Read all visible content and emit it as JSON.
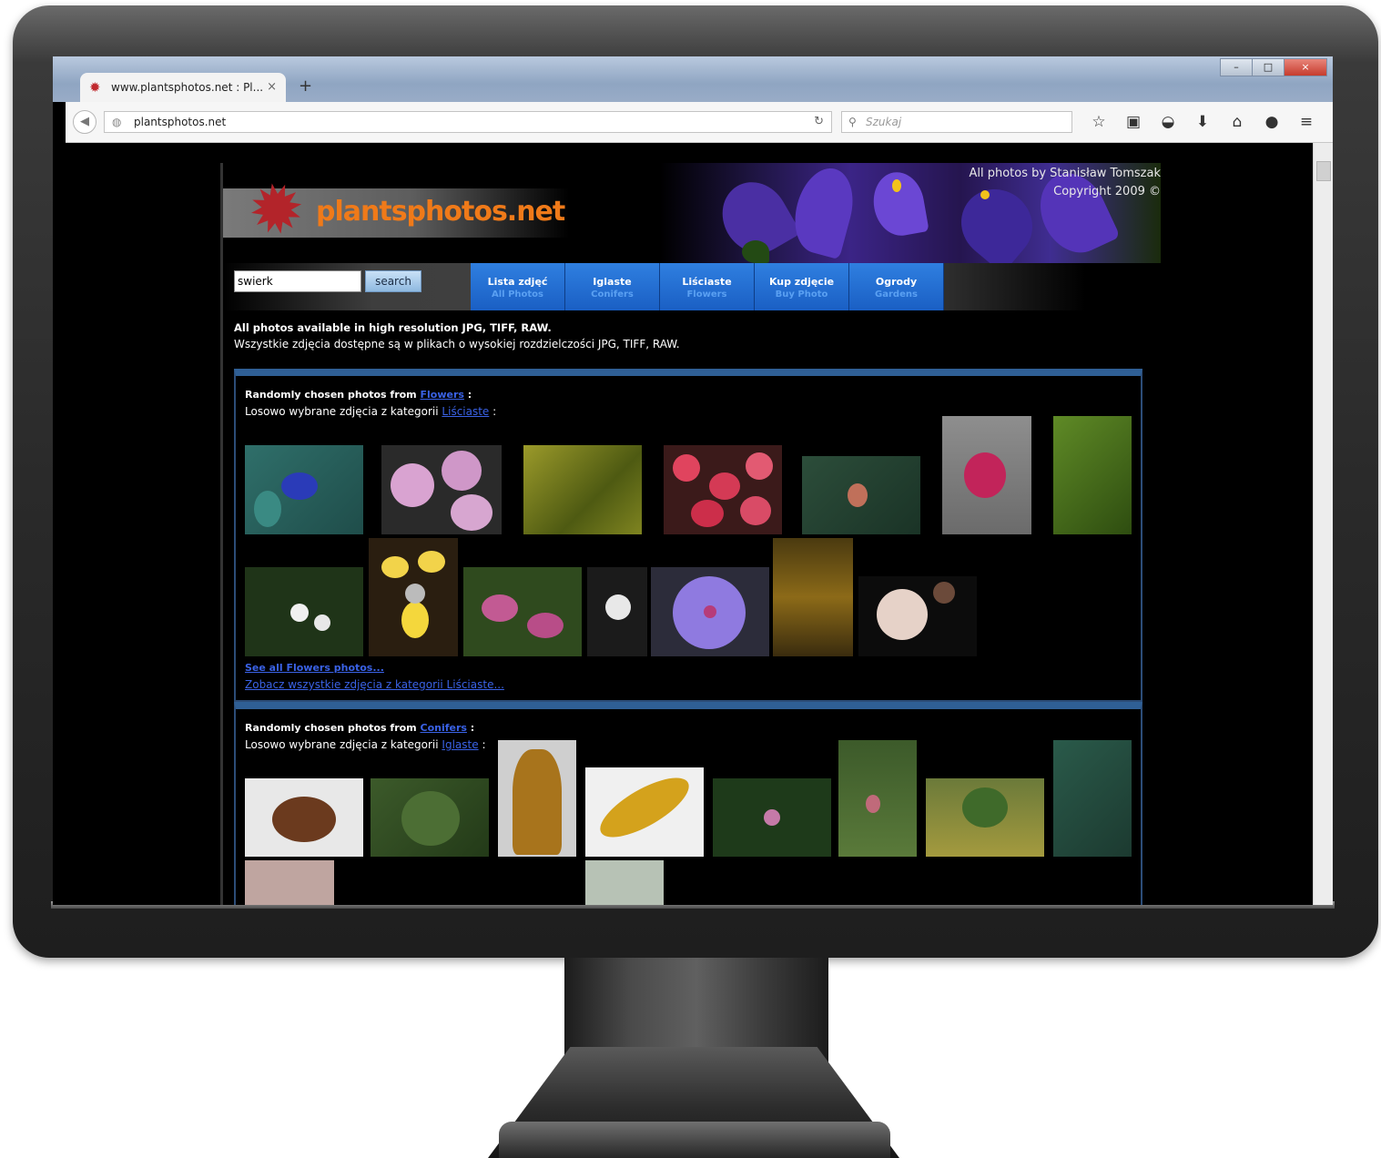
{
  "browser": {
    "tab_title": "www.plantsphotos.net : Pl...",
    "tab_close": "×",
    "new_tab": "+",
    "url": "plantsphotos.net",
    "search_placeholder": "Szukaj",
    "window_minimize": "–",
    "window_maximize": "□",
    "window_close": "×"
  },
  "site": {
    "logo": "plantsphotos.net",
    "credit_line1": "All photos by Stanisław Tomszak",
    "credit_line2": "Copyright 2009 ©",
    "search_value": "swierk",
    "search_button": "search",
    "menu": [
      {
        "pl": "Lista zdjęć",
        "en": "All Photos"
      },
      {
        "pl": "Iglaste",
        "en": "Conifers"
      },
      {
        "pl": "Liściaste",
        "en": "Flowers"
      },
      {
        "pl": "Kup zdjęcie",
        "en": "Buy Photo"
      },
      {
        "pl": "Ogrody",
        "en": "Gardens"
      }
    ],
    "intro_en": "All photos available in high resolution JPG, TIFF, RAW.",
    "intro_pl": "Wszystkie zdjęcia dostępne są w plikach o wysokiej rozdzielczości JPG, TIFF, RAW."
  },
  "sections": [
    {
      "head_en_prefix": "Randomly chosen photos from",
      "head_en_link": "Flowers",
      "head_en_suffix": ":",
      "head_pl_prefix": "Losowo wybrane zdjęcia z kategorii",
      "head_pl_link": "Liściaste",
      "head_pl_suffix": ":",
      "see_all_en": "See all Flowers photos...",
      "see_all_pl": "Zobacz wszystkie zdjęcia z kategorii Liściaste..."
    },
    {
      "head_en_prefix": "Randomly chosen photos from",
      "head_en_link": "Conifers",
      "head_en_suffix": ":",
      "head_pl_prefix": "Losowo wybrane zdjęcia z kategorii",
      "head_pl_link": "Iglaste",
      "head_pl_suffix": ":"
    }
  ],
  "colors": {
    "page_bg": "#000000",
    "logo_orange": "#f07a19",
    "menu_blue": "#1a5fc4",
    "link_blue": "#3a62e6",
    "section_border": "#2f5f95"
  }
}
